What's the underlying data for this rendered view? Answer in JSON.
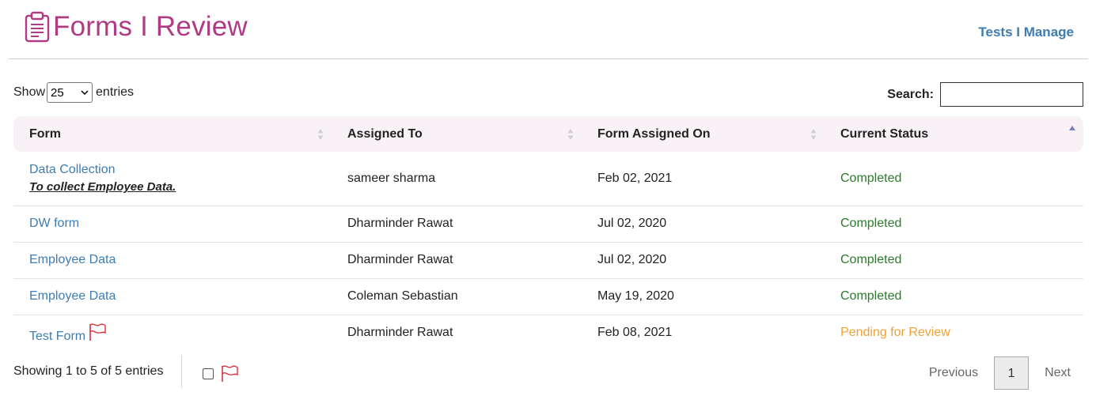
{
  "header": {
    "title": "Forms I Review",
    "link_label": "Tests I Manage"
  },
  "controls": {
    "show_label": "Show",
    "entries_label": "entries",
    "page_size": "25",
    "search_label": "Search:",
    "search_value": ""
  },
  "table": {
    "columns": [
      "Form",
      "Assigned To",
      "Form Assigned On",
      "Current Status"
    ],
    "rows": [
      {
        "form": "Data Collection",
        "description": "To collect Employee Data.",
        "assigned_to": "sameer sharma",
        "assigned_on": "Feb 02, 2021",
        "status": "Completed"
      },
      {
        "form": "DW form",
        "assigned_to": "Dharminder Rawat",
        "assigned_on": "Jul 02, 2020",
        "status": "Completed"
      },
      {
        "form": "Employee Data",
        "assigned_to": "Dharminder Rawat",
        "assigned_on": "Jul 02, 2020",
        "status": "Completed"
      },
      {
        "form": "Employee Data",
        "assigned_to": "Coleman Sebastian",
        "assigned_on": "May 19, 2020",
        "status": "Completed"
      },
      {
        "form": "Test Form",
        "flagged": true,
        "assigned_to": "Dharminder Rawat",
        "assigned_on": "Feb 08, 2021",
        "status": "Pending for Review"
      }
    ]
  },
  "footer": {
    "info": "Showing 1 to 5 of 5 entries",
    "previous_label": "Previous",
    "current_page": "1",
    "next_label": "Next"
  },
  "colors": {
    "title": "#b03a83",
    "link": "#3e7cb1",
    "completed": "#2c7a2c",
    "pending": "#f0a135",
    "flag": "#d9343c",
    "header_row": "#f8f2f7"
  },
  "icons": {
    "title_icon": "clipboard-icon",
    "flag_icon": "flag-icon",
    "sort_icon": "sort-arrows-icon"
  }
}
